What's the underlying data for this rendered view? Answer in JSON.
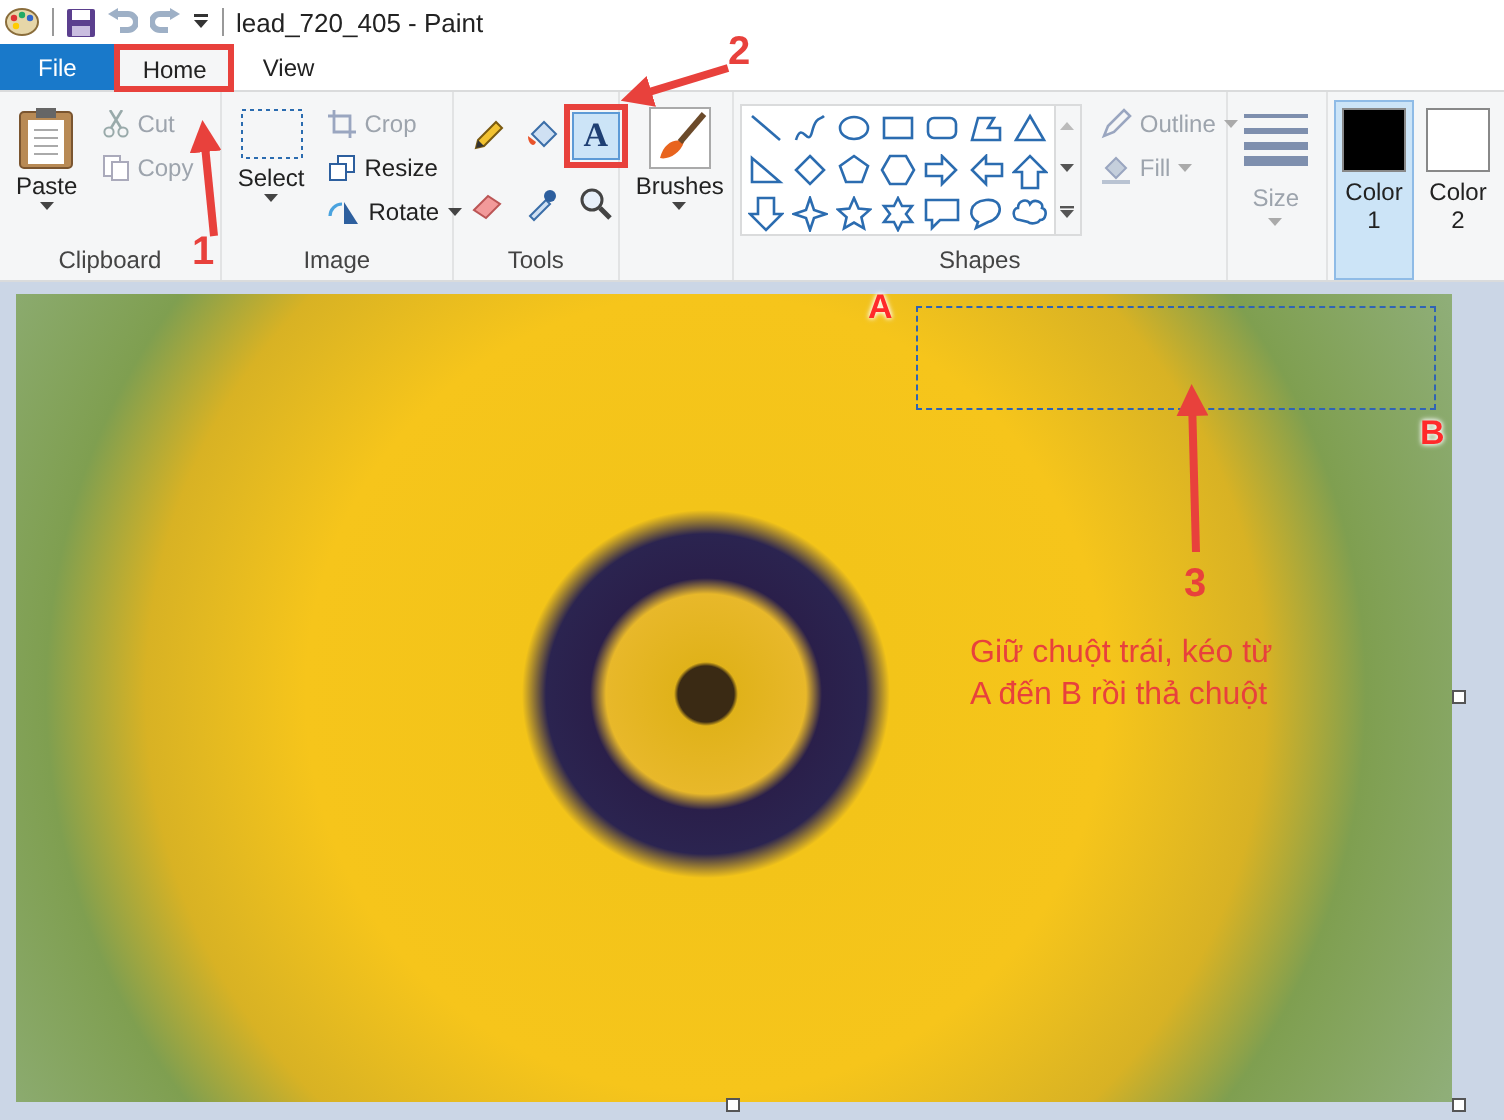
{
  "window": {
    "title": "lead_720_405 - Paint"
  },
  "tabs": [
    {
      "label": "File",
      "kind": "file",
      "selected": false,
      "callout": false
    },
    {
      "label": "Home",
      "kind": "tab",
      "selected": true,
      "callout": true
    },
    {
      "label": "View",
      "kind": "tab",
      "selected": false,
      "callout": false
    }
  ],
  "ribbon": {
    "clipboard": {
      "label": "Clipboard",
      "paste": "Paste",
      "actions": [
        {
          "label": "Cut",
          "kind": "cut",
          "disabled": true
        },
        {
          "label": "Copy",
          "kind": "copy",
          "disabled": true
        }
      ]
    },
    "image": {
      "label": "Image",
      "select": "Select",
      "actions": [
        {
          "label": "Crop",
          "kind": "crop",
          "disabled": true,
          "menu": false
        },
        {
          "label": "Resize",
          "kind": "resize",
          "disabled": false,
          "menu": false
        },
        {
          "label": "Rotate",
          "kind": "rotate",
          "disabled": false,
          "menu": true
        }
      ]
    },
    "tools": {
      "label": "Tools",
      "items": [
        {
          "kind": "pencil",
          "selected": false,
          "callout": false
        },
        {
          "kind": "fill",
          "selected": false,
          "callout": false
        },
        {
          "kind": "text",
          "glyph": "A",
          "selected": true,
          "callout": true
        },
        {
          "kind": "eraser",
          "selected": false,
          "callout": false
        },
        {
          "kind": "picker",
          "selected": false,
          "callout": false
        },
        {
          "kind": "magnifier",
          "selected": false,
          "callout": false
        }
      ]
    },
    "brushes": {
      "label": "Brushes"
    },
    "shapes": {
      "label": "Shapes",
      "options": [
        {
          "label": "Outline",
          "kind": "outline",
          "disabled": true
        },
        {
          "label": "Fill",
          "kind": "fill",
          "disabled": true
        }
      ]
    },
    "size": {
      "label": "Size",
      "disabled": true
    },
    "colors": [
      {
        "label": "Color 1",
        "color": "#000000",
        "selected": true
      },
      {
        "label": "Color 2",
        "color": "#ffffff",
        "selected": false
      }
    ]
  },
  "annotations": {
    "steps": [
      "1",
      "2",
      "3"
    ],
    "points": [
      "A",
      "B"
    ],
    "note": "Giữ chuột trái, kéo từ\nA đến B rồi thả chuột"
  }
}
